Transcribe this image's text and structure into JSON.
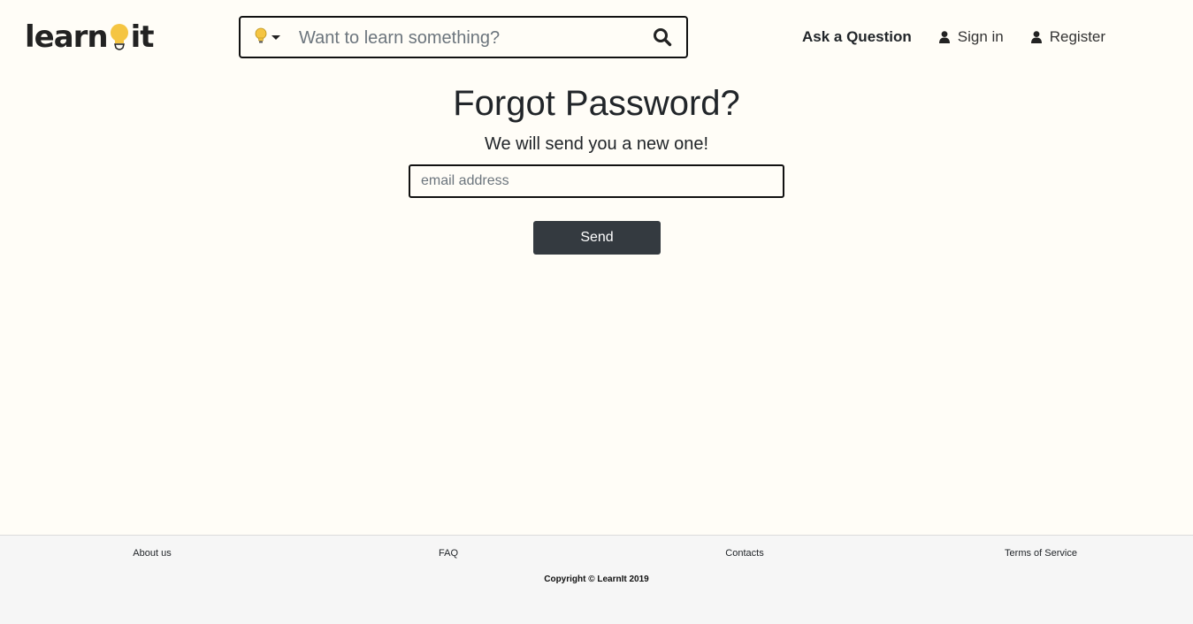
{
  "brand": {
    "logo_text_before": "learn",
    "logo_text_after": "it",
    "accent_color": "#f5c542"
  },
  "search": {
    "category_icon": "lightbulb-icon",
    "placeholder": "Want to learn something?",
    "value": ""
  },
  "nav": {
    "ask_label": "Ask a Question",
    "signin_label": "Sign in",
    "register_label": "Register"
  },
  "main": {
    "title": "Forgot Password?",
    "subtitle": "We will send you a new one!",
    "email_placeholder": "email address",
    "email_value": "",
    "send_label": "Send"
  },
  "footer": {
    "links": [
      "About us",
      "FAQ",
      "Contacts",
      "Terms of Service"
    ],
    "copyright": "Copyright © LearnIt 2019"
  },
  "colors": {
    "page_bg": "#fffdf7",
    "footer_bg": "#f6f6f6",
    "button_bg": "#343a40"
  }
}
